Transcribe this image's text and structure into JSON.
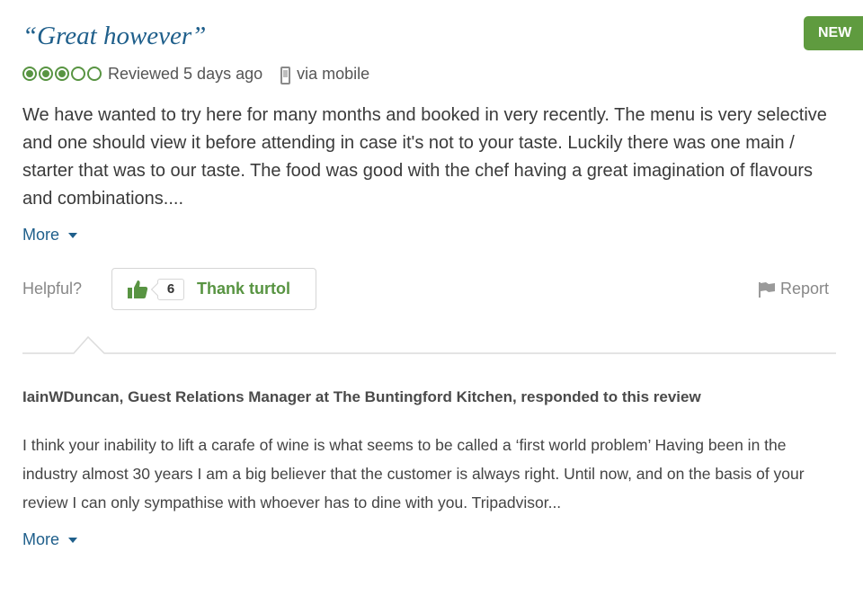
{
  "badge": {
    "new_label": "NEW"
  },
  "review": {
    "title": "“Great however”",
    "rating": {
      "value": 3,
      "max": 5,
      "color": "#589442"
    },
    "reviewed": "Reviewed 5 days ago",
    "via": "via mobile",
    "body": "We have wanted to try here for many months and booked in very recently. The menu is very selective and one should view it before attending in case it's not to your taste. Luckily there was one main / starter that was to our taste. The food was good with the chef having a great imagination of flavours and combinations....",
    "more_label": "More"
  },
  "actions": {
    "helpful_label": "Helpful?",
    "thank_count": "6",
    "thank_label": "Thank turtol",
    "report_label": "Report"
  },
  "response": {
    "header": "IainWDuncan, Guest Relations Manager at The Buntingford Kitchen, responded to this review",
    "body": "I think your inability to lift a carafe of wine is what seems to be called a ‘first world problem’ Having been in the industry almost 30 years I am a big believer that the customer is always right. Until now, and on the basis of your review I can only sympathise with whoever has to dine with you. Tripadvisor...",
    "more_label": "More"
  },
  "colors": {
    "title_blue": "#1f5f8b",
    "accent_green": "#589442",
    "badge_green": "#5f9b3f"
  },
  "icons": [
    "mobile-icon",
    "thumbs-up-icon",
    "flag-icon",
    "caret-down-icon"
  ]
}
